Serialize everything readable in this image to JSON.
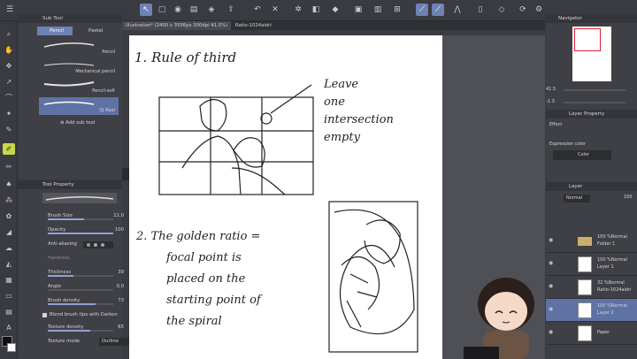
{
  "window": {
    "tab_label": "Illustration* (2400 x 3556px 300dpi 41.5%)",
    "tab2_label": "Ratio-1024aidri"
  },
  "subtool": {
    "title": "Sub Tool",
    "tabs": [
      "Pencil",
      "Pastel"
    ],
    "brushes": [
      "Pencil",
      "Mechanical pencil",
      "Pencil-soft",
      "DJ Real"
    ],
    "add_label": "Add sub tool"
  },
  "toolprop": {
    "title": "Tool Property",
    "rows": [
      {
        "label": "Brush Size",
        "value": "11.0"
      },
      {
        "label": "Opacity",
        "value": "100"
      },
      {
        "label": "Anti-aliasing",
        "value": ""
      },
      {
        "label": "Hardness",
        "value": ""
      },
      {
        "label": "Thickness",
        "value": "39"
      },
      {
        "label": "Angle",
        "value": "0.0"
      },
      {
        "label": "Brush density",
        "value": "73"
      },
      {
        "label": "Blend brush tips with Darken",
        "value": ""
      },
      {
        "label": "Texture density",
        "value": "65"
      },
      {
        "label": "Texture mode",
        "value": "Outline"
      }
    ]
  },
  "navigator": {
    "title": "Navigator",
    "zoom": "41.5",
    "angle": "-1.3"
  },
  "layer_property": {
    "title": "Layer Property",
    "effect": "Effect",
    "expr_label": "Expression color",
    "expr_value": "Color"
  },
  "layers": {
    "title": "Layer",
    "blend": "Normal",
    "opacity": "100",
    "items": [
      {
        "pct": "100 %Normal",
        "name": "Folder 1"
      },
      {
        "pct": "100 %Normal",
        "name": "Layer 1"
      },
      {
        "pct": "32 %Normal",
        "name": "Ratio-1024aidri"
      },
      {
        "pct": "100 %Normal",
        "name": "Layer 2"
      },
      {
        "pct": "",
        "name": "Paper"
      }
    ]
  },
  "notes": {
    "n1": "1. Rule of third",
    "leave": [
      "Leave",
      "one",
      "intersection",
      "empty"
    ],
    "n2": [
      "2. The golden ratio =",
      "focal point is",
      "placed on the",
      "starting point of",
      "the spiral"
    ]
  },
  "colors": {
    "accent": "#6e82b4",
    "tool_active": "#c9d84a",
    "panel": "#3f4045"
  }
}
